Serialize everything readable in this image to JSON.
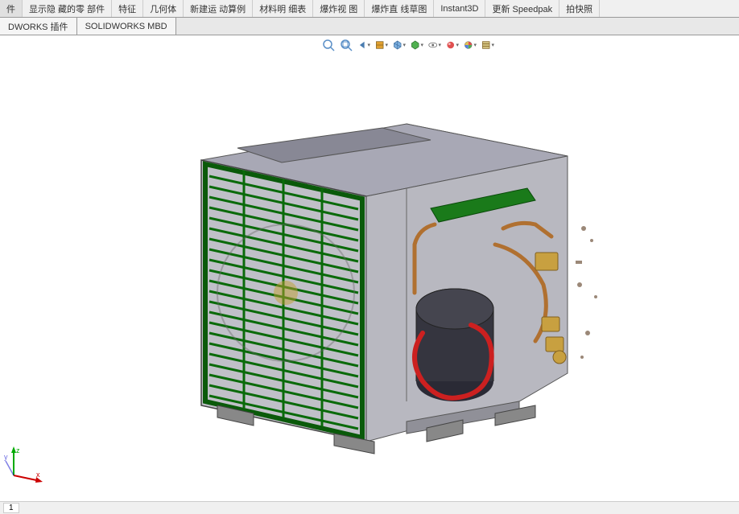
{
  "ribbon": {
    "items": [
      {
        "label": "件"
      },
      {
        "label": "显示隐\n藏的零\n部件"
      },
      {
        "label": "特征"
      },
      {
        "label": "几何体"
      },
      {
        "label": "新建运\n动算例"
      },
      {
        "label": "材料明\n细表"
      },
      {
        "label": "爆炸视\n图"
      },
      {
        "label": "爆炸直\n线草图"
      },
      {
        "label": "Instant3D"
      },
      {
        "label": "更新\nSpeedpak"
      },
      {
        "label": "拍快照"
      }
    ]
  },
  "tabs": [
    {
      "label": "DWORKS 插件"
    },
    {
      "label": "SOLIDWORKS MBD"
    }
  ],
  "viewToolbar": {
    "icons": [
      {
        "name": "zoom-fit-icon",
        "glyph": "🔍"
      },
      {
        "name": "zoom-area-icon",
        "glyph": "🔍"
      },
      {
        "name": "previous-view-icon",
        "glyph": "↶"
      },
      {
        "name": "section-view-icon",
        "glyph": "📐"
      },
      {
        "name": "view-orientation-icon",
        "glyph": "🧊"
      },
      {
        "name": "display-style-icon",
        "glyph": "🎨"
      },
      {
        "name": "hide-show-icon",
        "glyph": "👁"
      },
      {
        "name": "edit-appearance-icon",
        "glyph": "🌐"
      },
      {
        "name": "apply-scene-icon",
        "glyph": "🌈"
      },
      {
        "name": "view-settings-icon",
        "glyph": "📋"
      }
    ]
  },
  "coordAxes": {
    "x": "x",
    "y": "y",
    "z": "z"
  },
  "statusBar": {
    "tab": "1"
  }
}
